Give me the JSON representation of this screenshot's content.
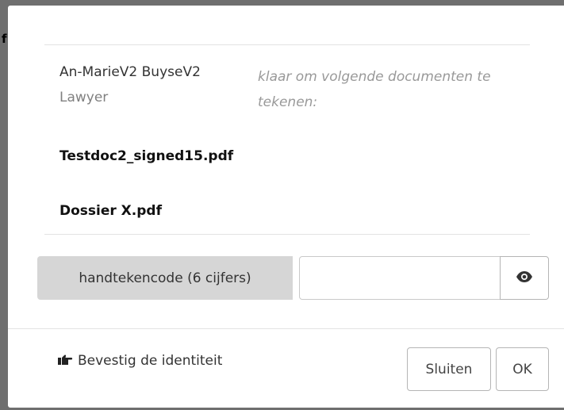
{
  "backdrop": {
    "glyph": "f"
  },
  "signer": {
    "name": "An-MarieV2 BuyseV2",
    "role": "Lawyer",
    "ready_text": "klaar om volgende documenten te tekenen:"
  },
  "documents": [
    {
      "name": "Testdoc2_signed15.pdf"
    },
    {
      "name": "Dossier X.pdf"
    }
  ],
  "code": {
    "label": "handtekencode (6 cijfers)",
    "value": "",
    "toggle_icon": "eye-icon"
  },
  "footer": {
    "icon": "hand-pointing-right-icon",
    "text": "Bevestig de identiteit",
    "close_label": "Sluiten",
    "ok_label": "OK"
  }
}
